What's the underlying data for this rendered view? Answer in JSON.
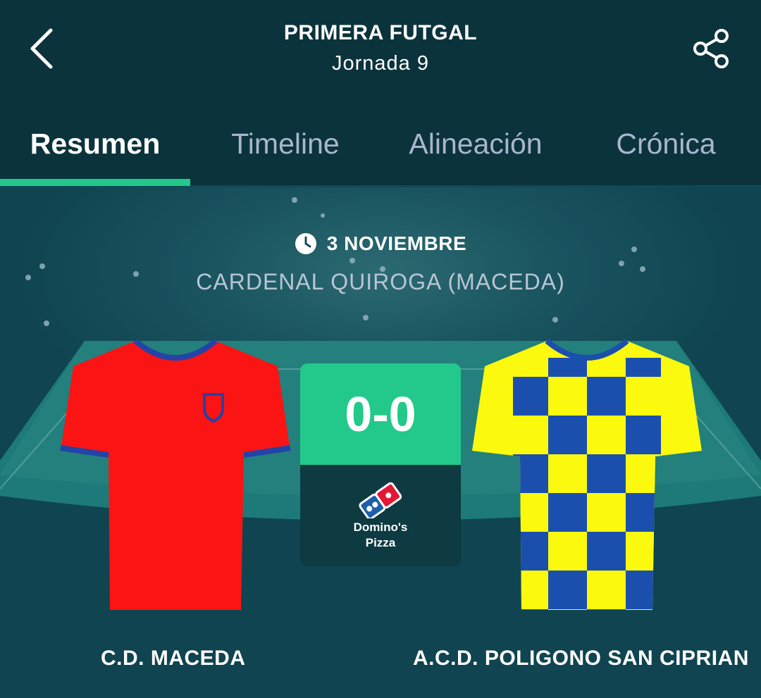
{
  "header": {
    "league": "PRIMERA FUTGAL",
    "round": "Jornada 9",
    "back_icon": "chevron-left-icon",
    "share_icon": "share-icon"
  },
  "tabs": [
    {
      "label": "Resumen",
      "active": true
    },
    {
      "label": "Timeline",
      "active": false
    },
    {
      "label": "Alineación",
      "active": false
    },
    {
      "label": "Crónica",
      "active": false
    }
  ],
  "match": {
    "date": "3 NOVIEMBRE",
    "venue": "CARDENAL QUIROGA (MACEDA)",
    "score": "0-0",
    "home_team": "C.D. MACEDA",
    "away_team": "A.C.D. POLIGONO SAN CIPRIAN",
    "sponsor_line1": "Domino's",
    "sponsor_line2": "Pizza"
  },
  "colors": {
    "accent": "#23c98a",
    "background": "#0b333c",
    "home_shirt": "#fb1414",
    "home_trim": "#2443a8",
    "away_shirt_yellow": "#fbf90e",
    "away_shirt_blue": "#1b4fae"
  }
}
